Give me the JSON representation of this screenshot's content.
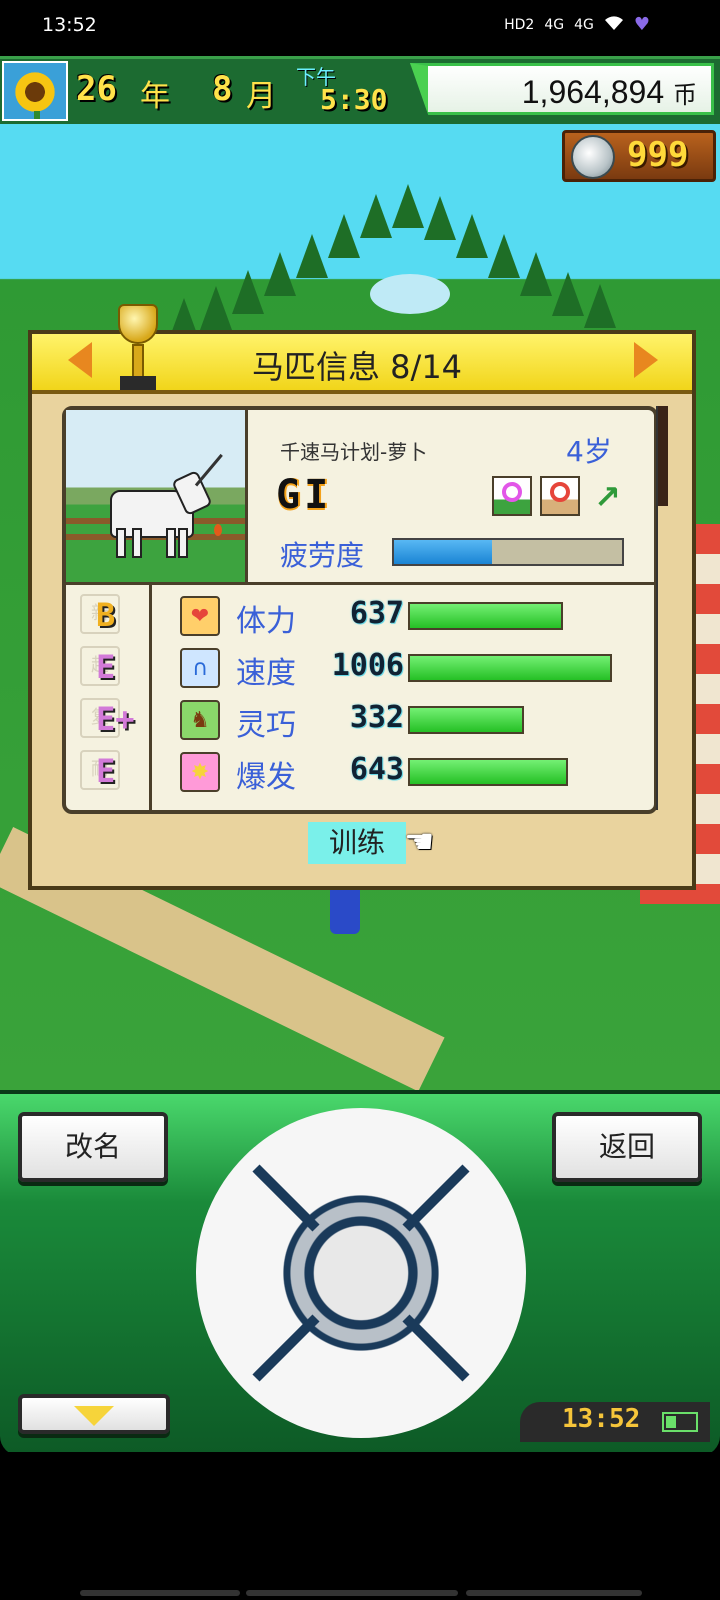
{
  "status_bar": {
    "time": "13:52",
    "indicators": [
      "HD2",
      "4G",
      "4G",
      "wifi-icon",
      "heart-icon"
    ]
  },
  "top_bar": {
    "year_value": "26",
    "year_unit": "年",
    "month_value": "8",
    "month_unit": "月",
    "ampm": "下午",
    "clock": "5:30",
    "money": "1,964,894",
    "money_unit": "币"
  },
  "coins": {
    "value": "999"
  },
  "panel": {
    "title": "马匹信息 8/14",
    "horse_name": "千速马计划-萝卜",
    "age": "4岁",
    "grade": "GI",
    "fatigue_label": "疲劳度",
    "fatigue_level": 0.43,
    "stats": [
      {
        "grade": "B",
        "grade_color": "#f0b020",
        "ghost": "新",
        "icon": "heart-icon",
        "icon_char": "❤",
        "icon_color": "#e6453a",
        "icon_bg": "#ffcf6a",
        "label": "体力",
        "value": "637",
        "level": 0.74
      },
      {
        "grade": "E",
        "grade_color": "#d27ad8",
        "ghost": "超",
        "icon": "horseshoe-icon",
        "icon_char": "∩",
        "icon_color": "#2a6ad8",
        "icon_bg": "#cfe6ff",
        "label": "速度",
        "value": "1006",
        "level": 0.97
      },
      {
        "grade": "E+",
        "grade_color": "#d27ad8",
        "ghost": "复",
        "icon": "horse-icon",
        "icon_char": "♞",
        "icon_color": "#7a3a10",
        "icon_bg": "#8ad86a",
        "label": "灵巧",
        "value": "332",
        "level": 0.55
      },
      {
        "grade": "E",
        "grade_color": "#d27ad8",
        "ghost": "耐",
        "icon": "burst-icon",
        "icon_char": "✸",
        "icon_color": "#f6d43a",
        "icon_bg": "#ff9ad8",
        "label": "爆发",
        "value": "643",
        "level": 0.76
      }
    ],
    "train_label": "训练"
  },
  "controls": {
    "rename_label": "改名",
    "return_label": "返回",
    "clock": "13:52"
  }
}
